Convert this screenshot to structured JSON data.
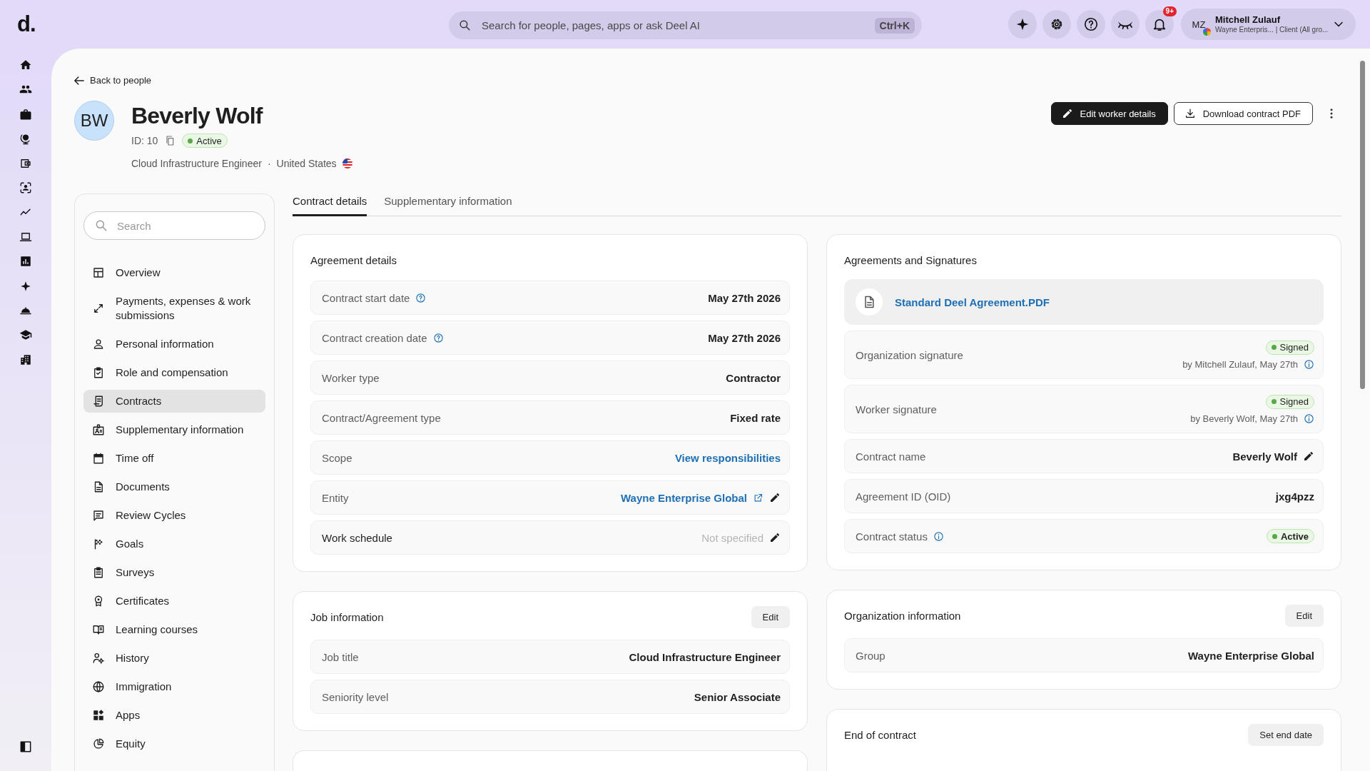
{
  "topbar": {
    "logo": "d.",
    "search": {
      "placeholder": "Search for people, pages, apps or ask Deel AI",
      "shortcut": "Ctrl+K"
    },
    "notifications": {
      "badge": "9+"
    },
    "user": {
      "initials": "MZ",
      "name": "Mitchell Zulauf",
      "subtitle": "Wayne Enterpris... | Client (All gro..."
    }
  },
  "back_link": "Back to people",
  "profile": {
    "initials": "BW",
    "name": "Beverly Wolf",
    "id": "ID: 10",
    "status": "Active",
    "job_title": "Cloud Infrastructure Engineer",
    "separator": "·",
    "country": "United States"
  },
  "actions": [
    {
      "label": "Edit worker details",
      "kind": "primary"
    },
    {
      "label": "Download contract PDF",
      "kind": "secondary"
    }
  ],
  "sidebar": {
    "search": {
      "placeholder": "Search"
    },
    "items": [
      {
        "label": "Overview",
        "selected": false
      },
      {
        "label": "Payments, expenses & work submissions",
        "selected": false
      },
      {
        "label": "Personal information",
        "selected": false
      },
      {
        "label": "Role and compensation",
        "selected": false
      },
      {
        "label": "Contracts",
        "selected": true
      },
      {
        "label": "Supplementary information",
        "selected": false
      },
      {
        "label": "Time off",
        "selected": false
      },
      {
        "label": "Documents",
        "selected": false
      },
      {
        "label": "Review Cycles",
        "selected": false
      },
      {
        "label": "Goals",
        "selected": false
      },
      {
        "label": "Surveys",
        "selected": false
      },
      {
        "label": "Certificates",
        "selected": false
      },
      {
        "label": "Learning courses",
        "selected": false
      },
      {
        "label": "History",
        "selected": false
      },
      {
        "label": "Immigration",
        "selected": false
      },
      {
        "label": "Apps",
        "selected": false
      },
      {
        "label": "Equity",
        "selected": false
      }
    ]
  },
  "tabs": [
    {
      "label": "Contract details",
      "selected": true
    },
    {
      "label": "Supplementary information",
      "selected": false
    }
  ],
  "columns": [
    [
      {
        "kind": "section",
        "title": "Agreement details",
        "rows": [
          {
            "kind": "text",
            "label": "Contract start date",
            "value": "May 27th 2026",
            "help": true
          },
          {
            "kind": "text",
            "label": "Contract creation date",
            "value": "May 27th 2026",
            "help": true
          },
          {
            "kind": "text",
            "label": "Worker type",
            "value": "Contractor"
          },
          {
            "kind": "text",
            "label": "Contract/Agreement type",
            "value": "Fixed rate"
          },
          {
            "kind": "link",
            "label": "Scope",
            "value": "View responsibilities"
          },
          {
            "kind": "link",
            "label": "Entity",
            "value": "Wayne Enterprise Global",
            "external": true,
            "editable": true
          },
          {
            "kind": "empty",
            "label": "Work schedule",
            "value": "Not specified",
            "editable": true
          }
        ]
      },
      {
        "kind": "section",
        "title": "Job information",
        "button": "Edit",
        "rows": [
          {
            "kind": "text",
            "label": "Job title",
            "value": "Cloud Infrastructure Engineer"
          },
          {
            "kind": "text",
            "label": "Seniority level",
            "value": "Senior Associate"
          }
        ]
      },
      {
        "kind": "cut"
      }
    ],
    [
      {
        "kind": "section",
        "title": "Agreements and Signatures",
        "document": "Standard Deel Agreement.PDF",
        "rows": [
          {
            "kind": "signature",
            "label": "Organization signature",
            "value": "Signed",
            "note": "by Mitchell Zulauf, May 27th"
          },
          {
            "kind": "signature",
            "label": "Worker signature",
            "value": "Signed",
            "note": "by Beverly Wolf, May 27th"
          },
          {
            "kind": "text",
            "label": "Contract name",
            "value": "Beverly Wolf",
            "editable": true
          },
          {
            "kind": "text",
            "label": "Agreement ID (OID)",
            "value": "jxg4pzz"
          },
          {
            "kind": "badge",
            "label": "Contract status",
            "value": "Active",
            "info": true
          }
        ]
      },
      {
        "kind": "section",
        "title": "Organization information",
        "button": "Edit",
        "rows": [
          {
            "kind": "text",
            "label": "Group",
            "value": "Wayne Enterprise Global"
          }
        ]
      },
      {
        "kind": "section",
        "title": "End of contract",
        "button": "Set end date"
      }
    ]
  ]
}
